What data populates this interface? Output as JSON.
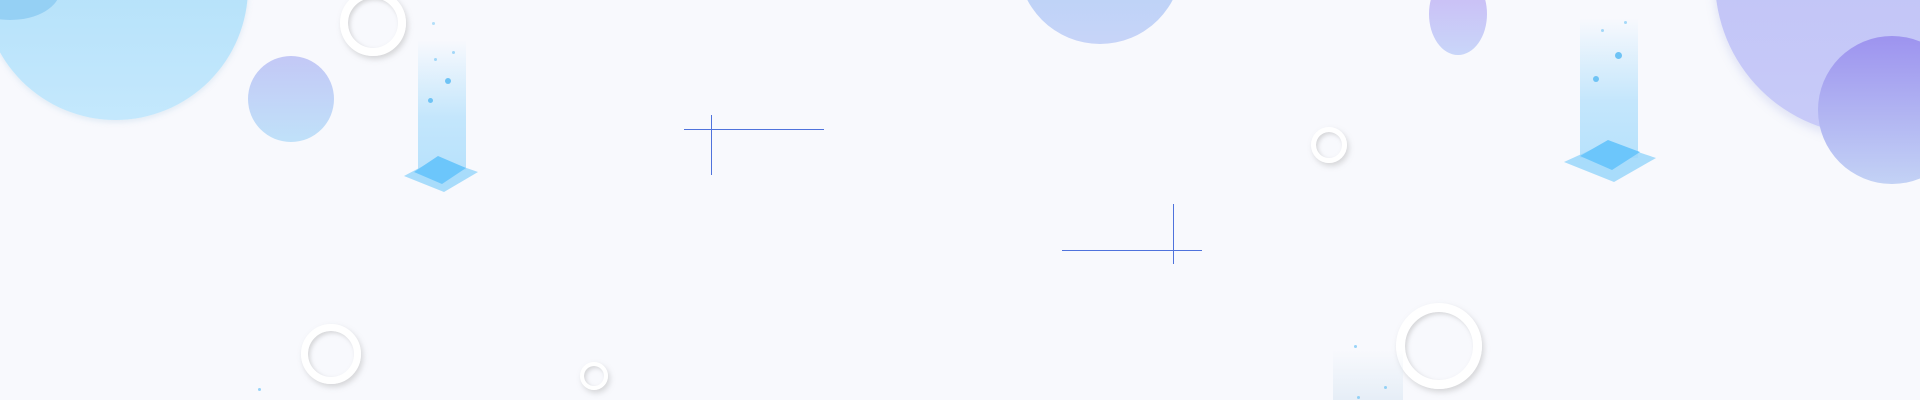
{
  "scene": {
    "background_color": "#f8f9fd",
    "accent_colors": [
      "#a9dcf7",
      "#c3c8f6",
      "#9d93ef",
      "#6ec3f5",
      "#4f73dc"
    ]
  }
}
